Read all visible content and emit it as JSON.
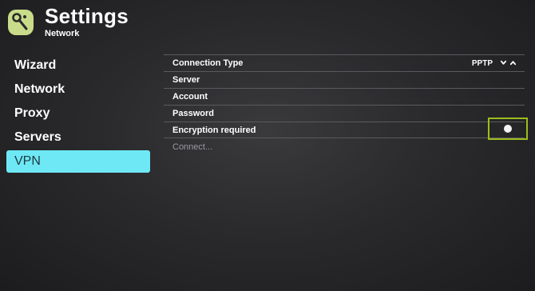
{
  "header": {
    "title": "Settings",
    "subtitle": "Network",
    "logo_icon": "app-logo-icon",
    "logo_color": "#c9dc8a"
  },
  "sidebar": {
    "items": [
      {
        "label": "Wizard",
        "active": false
      },
      {
        "label": "Network",
        "active": false
      },
      {
        "label": "Proxy",
        "active": false
      },
      {
        "label": "Servers",
        "active": false
      },
      {
        "label": "VPN",
        "active": true
      }
    ],
    "active_color": "#6fe8f5"
  },
  "settings": {
    "connection_type": {
      "label": "Connection Type",
      "value": "PPTP",
      "icons": [
        "chevron-down-icon",
        "chevron-up-icon"
      ]
    },
    "server": {
      "label": "Server"
    },
    "account": {
      "label": "Account"
    },
    "password": {
      "label": "Password"
    },
    "encryption": {
      "label": "Encryption required",
      "enabled": false,
      "focus_color": "#9cbd1c"
    },
    "connect": {
      "label": "Connect..."
    }
  }
}
